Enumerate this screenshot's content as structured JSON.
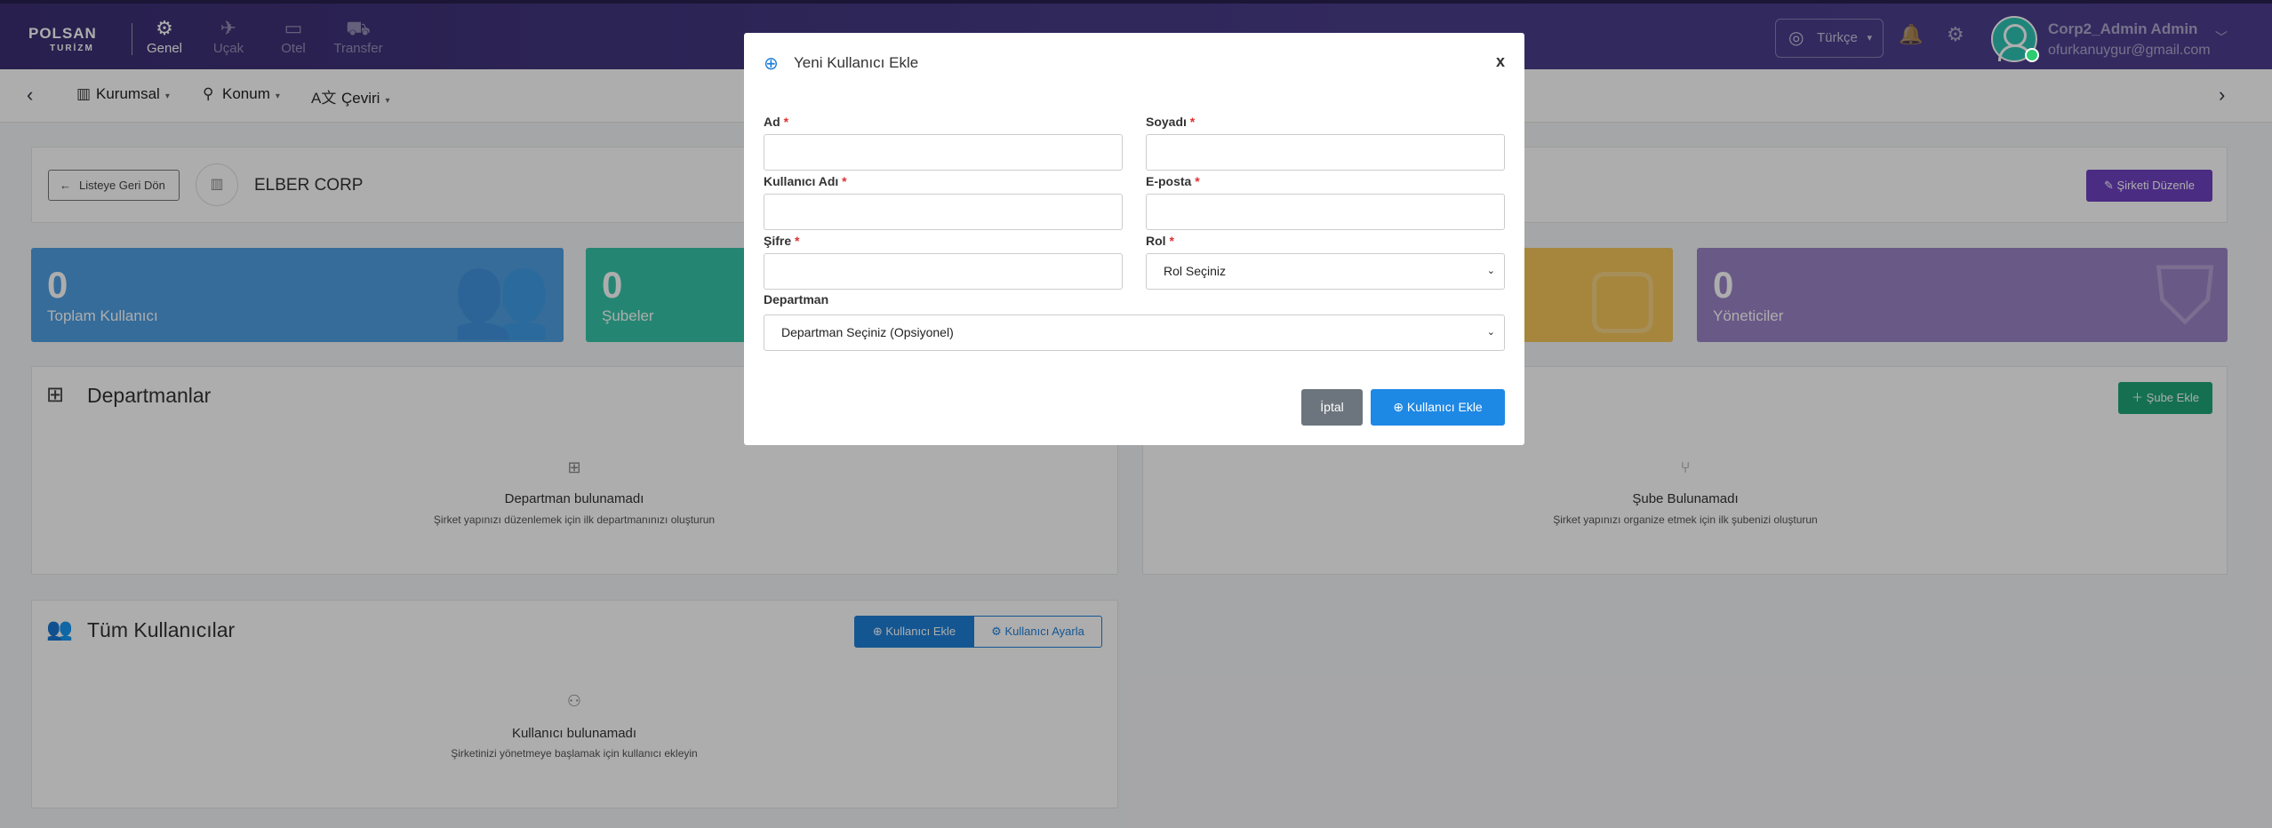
{
  "topbar": {
    "logo_main": "POLSAN",
    "logo_sub": "TURİZM",
    "nav": [
      {
        "label": "Genel",
        "icon": "gear-icon",
        "active": true
      },
      {
        "label": "Uçak",
        "icon": "plane-icon",
        "active": false
      },
      {
        "label": "Otel",
        "icon": "bed-icon",
        "active": false
      },
      {
        "label": "Transfer",
        "icon": "car-icon",
        "active": false
      }
    ],
    "language": "Türkçe",
    "user_name": "Corp2_Admin Admin",
    "user_email": "ofurkanuygur@gmail.com"
  },
  "subnav": {
    "items": [
      {
        "label": "Kurumsal",
        "icon": "building-icon"
      },
      {
        "label": "Konum",
        "icon": "location-pin-icon"
      },
      {
        "label": "Çeviri",
        "icon": "translate-icon"
      }
    ]
  },
  "company": {
    "back_label": "Listeye Geri Dön",
    "name": "ELBER CORP",
    "edit_label": "Şirketi Düzenle"
  },
  "stats": [
    {
      "value": "0",
      "label": "Toplam Kullanıcı",
      "color": "#4f9fe3"
    },
    {
      "value": "0",
      "label": "Şubeler",
      "color": "#35c6a9"
    },
    {
      "value": "",
      "label": "",
      "color": "#f5c45a"
    },
    {
      "value": "0",
      "label": "Yöneticiler",
      "color": "#9b84c8"
    }
  ],
  "departments": {
    "title": "Departmanlar",
    "empty_title": "Departman bulunamadı",
    "empty_sub": "Şirket yapınızı düzenlemek için ilk departmanınızı oluşturun"
  },
  "branches": {
    "add_label": "Şube Ekle",
    "empty_title": "Şube Bulunamadı",
    "empty_sub": "Şirket yapınızı organize etmek için ilk şubenizi oluşturun"
  },
  "users": {
    "title": "Tüm Kullanıcılar",
    "add_label": "Kullanıcı Ekle",
    "settings_label": "Kullanıcı Ayarla",
    "empty_title": "Kullanıcı bulunamadı",
    "empty_sub": "Şirketinizi yönetmeye başlamak için kullanıcı ekleyin"
  },
  "modal": {
    "title": "Yeni Kullanıcı Ekle",
    "close": "x",
    "fields": {
      "first_name": {
        "label": "Ad",
        "value": ""
      },
      "last_name": {
        "label": "Soyadı",
        "value": ""
      },
      "username": {
        "label": "Kullanıcı Adı",
        "value": ""
      },
      "email": {
        "label": "E-posta",
        "value": ""
      },
      "password": {
        "label": "Şifre",
        "value": ""
      },
      "role": {
        "label": "Rol",
        "selected": "Rol Seçiniz"
      },
      "department": {
        "label": "Departman",
        "selected": "Departman Seçiniz (Opsiyonel)"
      }
    },
    "required_mark": "*",
    "cancel_label": "İptal",
    "submit_label": "Kullanıcı Ekle"
  }
}
